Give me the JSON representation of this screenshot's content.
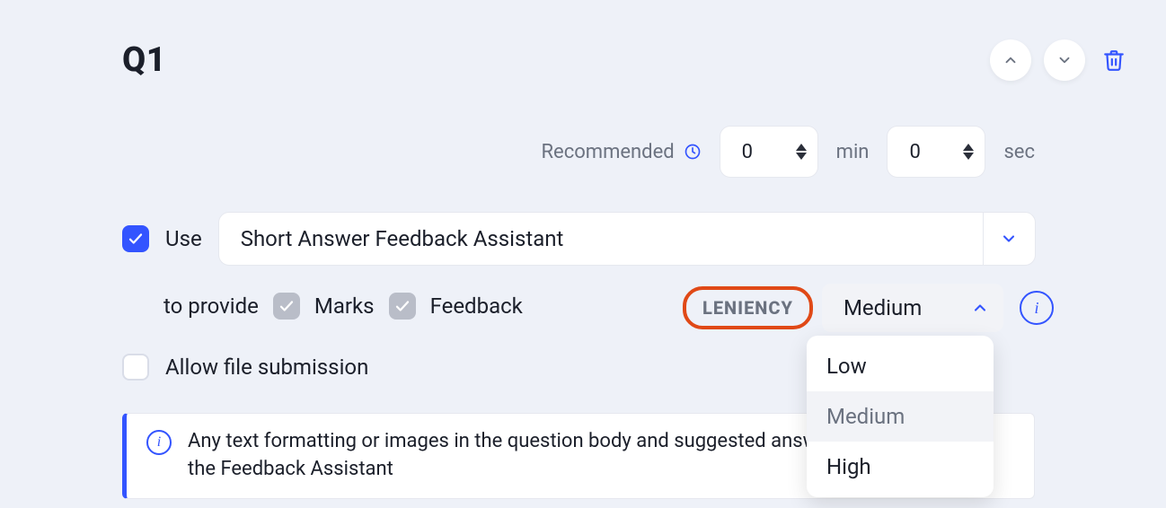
{
  "header": {
    "title": "Q1"
  },
  "recommended": {
    "label": "Recommended",
    "min_value": "0",
    "min_unit": "min",
    "sec_value": "0",
    "sec_unit": "sec"
  },
  "use": {
    "label": "Use",
    "assistant": "Short Answer Feedback Assistant"
  },
  "provide": {
    "label": "to provide",
    "marks_label": "Marks",
    "feedback_label": "Feedback"
  },
  "leniency": {
    "badge": "LENIENCY",
    "value": "Medium",
    "options": [
      "Low",
      "Medium",
      "High"
    ],
    "selected_index": 1
  },
  "file_submission": {
    "label": "Allow file submission"
  },
  "info": {
    "text": "Any text formatting or images in the question body and suggested answer will not be sent to the Feedback Assistant"
  }
}
